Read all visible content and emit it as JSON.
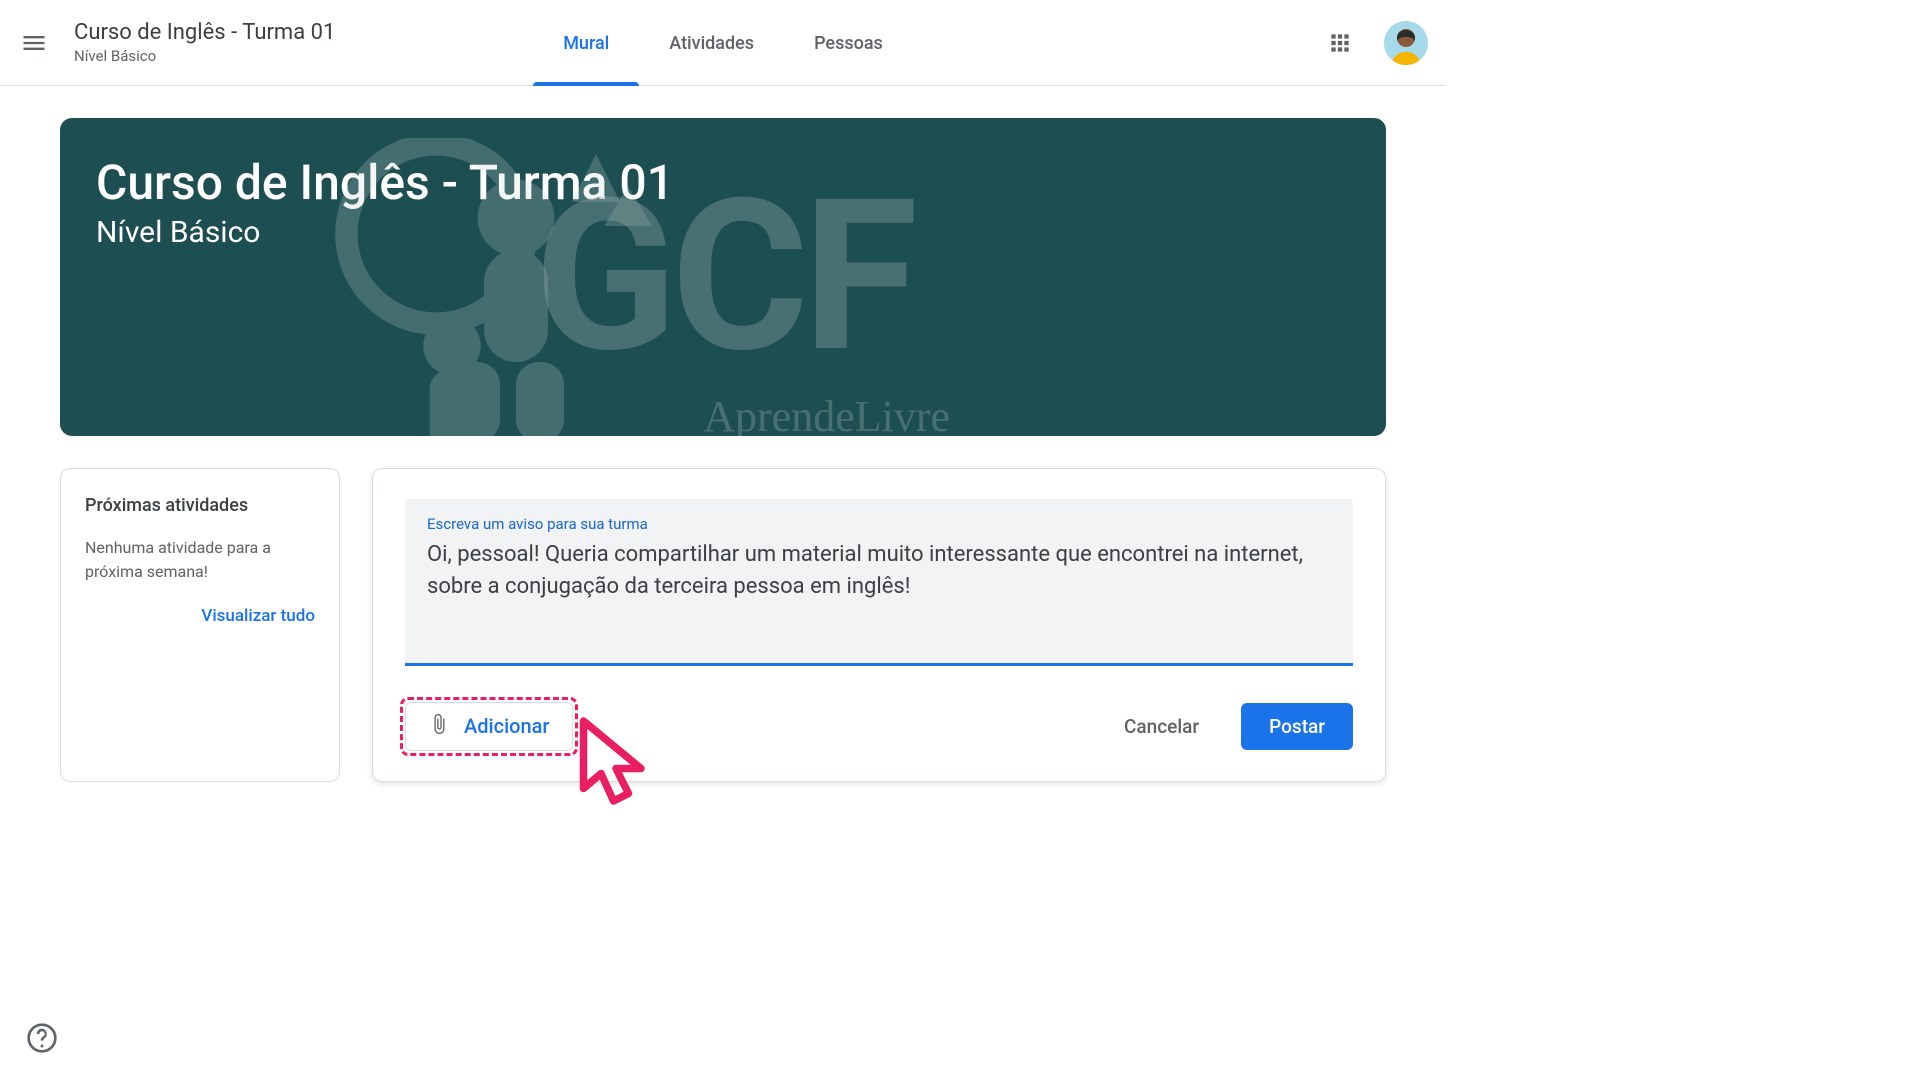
{
  "colors": {
    "accent": "#1a73e8",
    "banner": "#1d4f52",
    "highlight": "#e91e63"
  },
  "header": {
    "class_title": "Curso de Inglês - Turma 01",
    "class_subtitle": "Nível Básico",
    "tabs": [
      {
        "label": "Mural",
        "active": true
      },
      {
        "label": "Atividades",
        "active": false
      },
      {
        "label": "Pessoas",
        "active": false
      }
    ]
  },
  "banner": {
    "title": "Curso de Inglês - Turma 01",
    "subtitle": "Nível Básico",
    "watermark_main": "GCF",
    "watermark_sub": "AprendeLivre"
  },
  "sidebar": {
    "heading": "Próximas atividades",
    "empty_text": "Nenhuma atividade para a próxima semana!",
    "view_all": "Visualizar tudo"
  },
  "composer": {
    "placeholder_label": "Escreva um aviso para sua turma",
    "body": "Oi, pessoal! Queria compartilhar um material muito interessante que encontrei na internet, sobre a conjugação da terceira pessoa em inglês!",
    "add_label": "Adicionar",
    "cancel_label": "Cancelar",
    "post_label": "Postar"
  }
}
